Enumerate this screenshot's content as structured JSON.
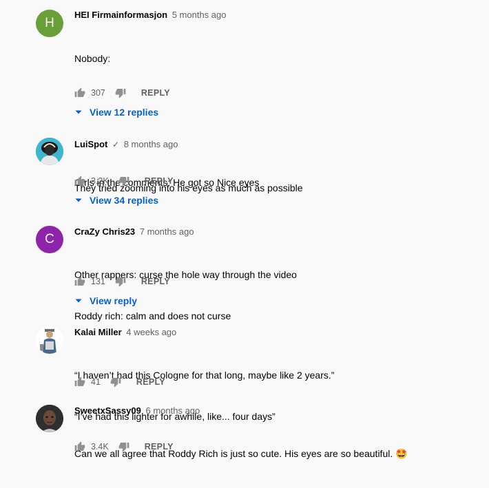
{
  "comments": [
    {
      "author": "HEI Firmainformasjon",
      "time": "5 months ago",
      "avatar_letter": "H",
      "avatar_color": "#689f38",
      "lines": [
        "Nobody:",
        "",
        "",
        "Girls in the comments: He got so Nice eyes"
      ],
      "likes": "307",
      "reply_label": "REPLY",
      "replies_label": "View 12 replies"
    },
    {
      "author": "LuiSpot",
      "time": "8 months ago",
      "verified": "✓",
      "avatar_icon": "silhouette-photo-avatar",
      "lines": [
        "They tried zooming into his eyes as much as possible"
      ],
      "likes": "3.2K",
      "reply_label": "REPLY",
      "replies_label": "View 34 replies"
    },
    {
      "author": "CraZy Chris23",
      "time": "7 months ago",
      "avatar_letter": "C",
      "avatar_color": "#8e24aa",
      "lines": [
        "Other rappers: curse the hole way through the video",
        "Roddy rich: calm and does not curse"
      ],
      "likes": "131",
      "reply_label": "REPLY",
      "replies_label": "View reply"
    },
    {
      "author": "Kalai Miller",
      "time": "4 weeks ago",
      "avatar_icon": "figure-photo-avatar",
      "lines": [
        "“I haven’t had this Cologne for that long, maybe like 2 years.”",
        "“I’ve had this lighter for awhile, like... four days”"
      ],
      "likes": "41",
      "reply_label": "REPLY"
    },
    {
      "author": "SweetxSassy09",
      "time": "6 months ago",
      "avatar_icon": "portrait-photo-avatar",
      "lines": [
        "Can we all agree that Roddy Rich is just so cute. His eyes are so beautiful. 🤩"
      ],
      "likes": "3.4K",
      "reply_label": "REPLY"
    }
  ],
  "icons": {
    "like": "thumbs-up-icon",
    "dislike": "thumbs-down-icon",
    "expand": "caret-down-icon"
  },
  "colors": {
    "link": "#065fd4",
    "meta": "#606060",
    "background": "#f9f9f9"
  }
}
